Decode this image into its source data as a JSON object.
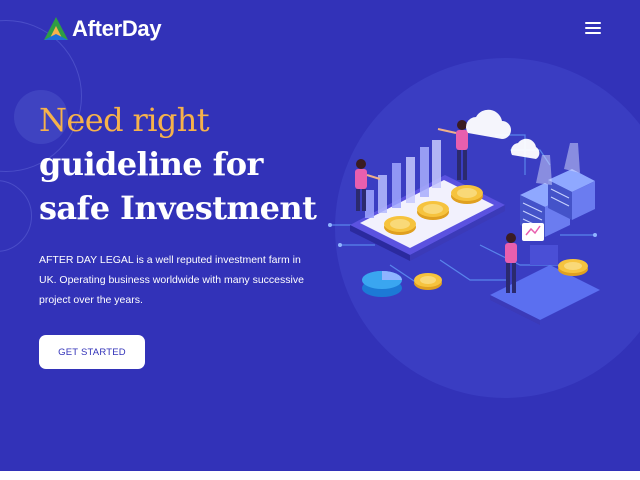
{
  "brand": {
    "name": "AfterDay",
    "logo_icon": "afterday-logo-icon",
    "colors": {
      "primary_bg": "#3232b8",
      "accent_orange": "#f6b24b",
      "white": "#ffffff"
    }
  },
  "nav": {
    "menu_icon": "hamburger-menu-icon"
  },
  "hero": {
    "headline_line1": "Need right",
    "headline_line2": "guideline for",
    "headline_line3": "safe Investment",
    "description": "AFTER DAY LEGAL is a well reputed investment farm in UK. Operating business worldwide with many successive project over the years.",
    "cta_label": "GET STARTED",
    "illustration": "isometric-investment-illustration"
  }
}
